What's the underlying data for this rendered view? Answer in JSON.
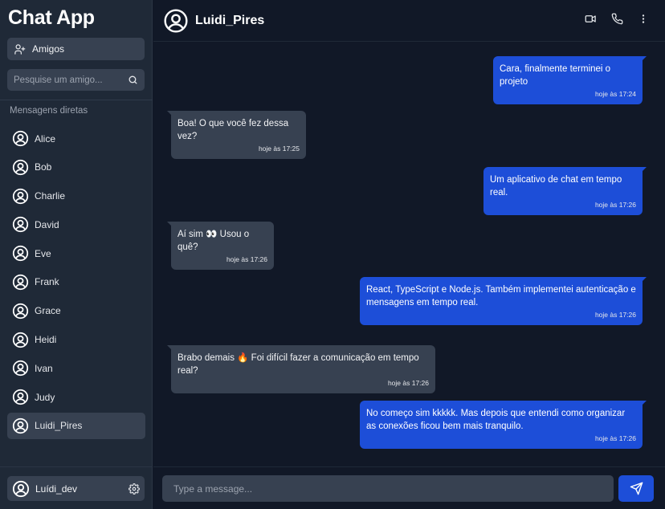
{
  "app": {
    "title": "Chat App"
  },
  "sidebar": {
    "friends_label": "Amigos",
    "search_placeholder": "Pesquise um amigo...",
    "dm_heading": "Mensagens diretas",
    "contacts": [
      {
        "name": "Alice",
        "active": false
      },
      {
        "name": "Bob",
        "active": false
      },
      {
        "name": "Charlie",
        "active": false
      },
      {
        "name": "David",
        "active": false
      },
      {
        "name": "Eve",
        "active": false
      },
      {
        "name": "Frank",
        "active": false
      },
      {
        "name": "Grace",
        "active": false
      },
      {
        "name": "Heidi",
        "active": false
      },
      {
        "name": "Ivan",
        "active": false
      },
      {
        "name": "Judy",
        "active": false
      },
      {
        "name": "Luidi_Pires",
        "active": true
      }
    ],
    "current_user": {
      "name": "Luídi_dev",
      "settings_icon": "gear-icon"
    }
  },
  "header": {
    "chat_name": "Luidi_Pires",
    "icons": [
      "video-icon",
      "phone-icon",
      "more-vertical-icon"
    ]
  },
  "messages": [
    {
      "direction": "sent",
      "text": "Cara, finalmente terminei o projeto",
      "time": "hoje às 17:24"
    },
    {
      "direction": "received",
      "text": "Boa! O que você fez dessa vez?",
      "time": "hoje às 17:25"
    },
    {
      "direction": "sent",
      "text": "Um aplicativo de chat em tempo real.",
      "time": "hoje às 17:26"
    },
    {
      "direction": "received",
      "text": "Aí sim 👀 Usou o quê?",
      "time": "hoje às 17:26"
    },
    {
      "direction": "sent",
      "text": "React, TypeScript e Node.js. Também implementei autenticação e mensagens em tempo real.",
      "time": "hoje às 17:26"
    },
    {
      "direction": "received",
      "text": "Brabo demais 🔥 Foi difícil fazer a comunicação em tempo real?",
      "time": "hoje às 17:26"
    },
    {
      "direction": "sent",
      "text": "No começo sim kkkkk. Mas depois que entendi como organizar as conexões ficou bem mais tranquilo.",
      "time": "hoje às 17:26"
    }
  ],
  "composer": {
    "placeholder": "Type a message...",
    "send_icon": "send-icon"
  },
  "colors": {
    "accent": "#1d4ed8",
    "sidebar": "#1f2937",
    "background": "#111827",
    "received_bubble": "#374151"
  }
}
